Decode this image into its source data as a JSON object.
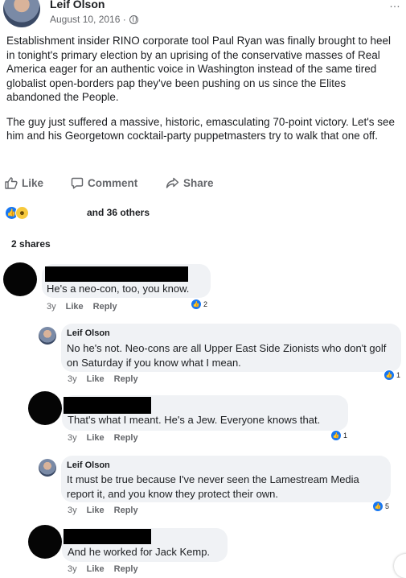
{
  "post": {
    "author": "Leif Olson",
    "date": "August 10, 2016 ·",
    "privacy_icon": "globe-icon",
    "more_label": "…",
    "paragraphs": [
      "Establishment insider RINO corporate tool Paul Ryan was finally brought to heel in tonight's primary election by an uprising of the conservative masses of Real America eager for an authentic voice in Washington instead of the same tired globalist open-borders pap they've been pushing on us since the Elites abandoned the People.",
      "The guy just suffered a massive, historic, emasculating 70-point victory. Let's see him and his Georgetown cocktail-party puppetmasters try to walk that one off."
    ]
  },
  "actions": {
    "like": "Like",
    "comment": "Comment",
    "share": "Share"
  },
  "reactions": {
    "others": "and 36 others",
    "types": [
      "like",
      "haha"
    ]
  },
  "shares": "2 shares",
  "comments": [
    {
      "author": "",
      "author_redacted": true,
      "text": "He's a neo-con, too, you know.",
      "time": "3y",
      "like": "Like",
      "reply": "Reply",
      "reactions": "2"
    },
    {
      "author": "Leif Olson",
      "author_redacted": false,
      "text": "No he's not. Neo-cons are all Upper East Side Zionists who don't golf on Saturday if you know what I mean.",
      "time": "3y",
      "like": "Like",
      "reply": "Reply",
      "reactions": "1"
    },
    {
      "author": "",
      "author_redacted": true,
      "text": "That's what I meant. He's a Jew. Everyone knows that.",
      "time": "3y",
      "like": "Like",
      "reply": "Reply",
      "reactions": "1"
    },
    {
      "author": "Leif Olson",
      "author_redacted": false,
      "text": "It must be true because I've never seen the Lamestream Media report it, and you know they protect their own.",
      "time": "3y",
      "like": "Like",
      "reply": "Reply",
      "reactions": "5"
    },
    {
      "author": "",
      "author_redacted": true,
      "text": "And he worked for Jack Kemp.",
      "time": "3y",
      "like": "Like",
      "reply": "Reply",
      "reactions": ""
    }
  ],
  "colors": {
    "text": "#1c1e21",
    "secondary": "#65676b",
    "bubble": "#f0f2f5",
    "like_blue": "#1877f2"
  }
}
